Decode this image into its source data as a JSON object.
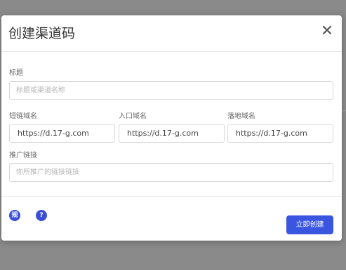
{
  "dialog": {
    "title": "创建渠道码",
    "close_glyph": "×"
  },
  "form": {
    "title_field": {
      "label": "标题",
      "placeholder": "标题或渠道名称"
    },
    "short_domain": {
      "label": "短链域名",
      "value": "https://d.17-g.com"
    },
    "entry_domain": {
      "label": "入口域名",
      "value": "https://d.17-g.com"
    },
    "landing_domain": {
      "label": "落地域名",
      "value": "https://d.17-g.com"
    },
    "promo_link": {
      "label": "推广链接",
      "placeholder": "你所推广的链接链接"
    }
  },
  "footer": {
    "rules_icon_glyph": "规",
    "help_icon_glyph": "?",
    "create_button_label": "立即创建"
  },
  "colors": {
    "accent": "#3a56e0",
    "icon_accent": "#3a4fd6",
    "overlay": "#8a8a8a"
  }
}
